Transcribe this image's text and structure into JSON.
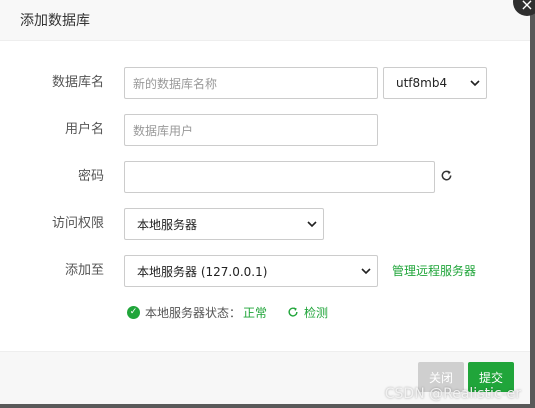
{
  "dialog": {
    "title": "添加数据库",
    "close_icon": "×"
  },
  "form": {
    "db_name": {
      "label": "数据库名",
      "placeholder": "新的数据库名称"
    },
    "charset": {
      "value": "utf8mb4"
    },
    "username": {
      "label": "用户名",
      "placeholder": "数据库用户"
    },
    "password": {
      "label": "密码",
      "value": ""
    },
    "access": {
      "label": "访问权限",
      "value": "本地服务器"
    },
    "add_to": {
      "label": "添加至",
      "value": "本地服务器 (127.0.0.1)",
      "manage_link": "管理远程服务器"
    },
    "status": {
      "text": "本地服务器状态：",
      "state": "正常",
      "detect": "检测"
    }
  },
  "footer": {
    "cancel_label": "关闭",
    "submit_label": "提交"
  },
  "watermark": "CSDN @Realistic-er",
  "colors": {
    "accent": "#20a53a",
    "disabled": "#cfcfcf"
  }
}
